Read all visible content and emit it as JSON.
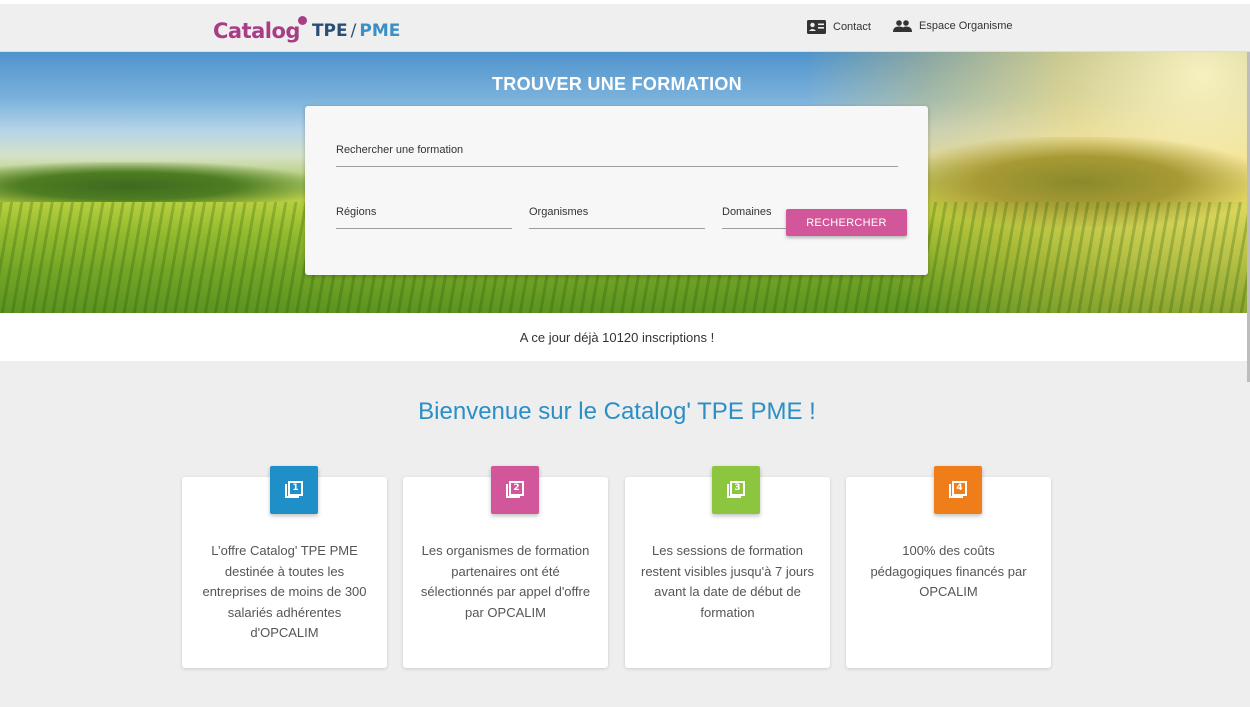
{
  "header": {
    "logo": {
      "catalog": "Catalog",
      "tpe": "TPE",
      "slash": "/",
      "pme": "PME"
    },
    "nav": [
      {
        "label": "Contact",
        "icon": "contact-card-icon"
      },
      {
        "label": "Espace Organisme",
        "icon": "people-icon"
      }
    ]
  },
  "hero": {
    "title": "TROUVER UNE FORMATION",
    "search": {
      "main_label": "Rechercher une formation",
      "regions_label": "Régions",
      "organismes_label": "Organismes",
      "domaines_label": "Domaines",
      "button_label": "RECHERCHER"
    }
  },
  "counter": {
    "text": "A ce jour déjà 10120 inscriptions !"
  },
  "welcome": {
    "title": "Bienvenue sur le Catalog' TPE PME !",
    "cards": [
      {
        "number": "1",
        "color": "#1e8fc7",
        "text": "L’offre Catalog' TPE PME destinée à toutes les entreprises de moins de 300 salariés adhérentes d'OPCALIM"
      },
      {
        "number": "2",
        "color": "#d2579a",
        "text": "Les organismes de formation partenaires ont été sélectionnés par appel d'offre par OPCALIM"
      },
      {
        "number": "3",
        "color": "#8cc63e",
        "text": "Les sessions de formation restent visibles jusqu'à 7 jours avant la date de début de formation"
      },
      {
        "number": "4",
        "color": "#ef7d1a",
        "text": "100% des coûts pédagogiques financés par OPCALIM"
      }
    ]
  },
  "colors": {
    "accent_pink": "#d2579a",
    "title_blue": "#2b8fc6",
    "logo_purple": "#a83d86"
  }
}
